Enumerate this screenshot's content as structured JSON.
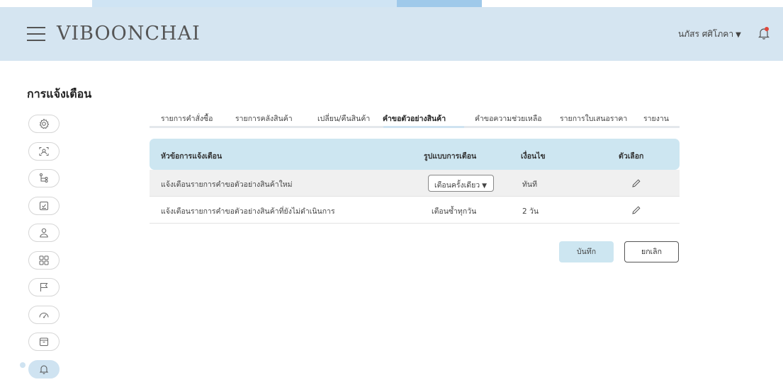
{
  "header": {
    "brand": "VIBOONCHAI",
    "user_name": "นภัสร ศศิโภคา",
    "user_caret": "▼"
  },
  "page": {
    "title": "การแจ้งเตือน"
  },
  "sidebar": {
    "icons": [
      "gear-icon",
      "user-scan-icon",
      "flow-icon",
      "checkbox-icon",
      "person-icon",
      "grid-icon",
      "flag-icon",
      "gauge-icon",
      "box-icon",
      "bell-icon"
    ],
    "active_index": 9
  },
  "tabs": [
    {
      "label": "รายการคำสั่งซื้อ",
      "active": false
    },
    {
      "label": "รายการคลังสินค้า",
      "active": false
    },
    {
      "label": "เปลี่ยน/คืนสินค้า",
      "active": false
    },
    {
      "label": "คำขอตัวอย่างสินค้า",
      "active": true
    },
    {
      "label": "คำขอความช่วยเหลือ",
      "active": false
    },
    {
      "label": "รายการใบเสนอราคา",
      "active": false
    },
    {
      "label": "รายงาน",
      "active": false
    }
  ],
  "table": {
    "columns": [
      "หัวข้อการแจ้งเตือน",
      "รูปแบบการเตือน",
      "เงื่อนไข",
      "ตัวเลือก"
    ],
    "rows": [
      {
        "topic": "แจ้งเตือนรายการคำขอตัวอย่างสินค้าใหม่",
        "mode": "เตือนครั้งเดียว",
        "mode_is_select": true,
        "condition": "ทันที"
      },
      {
        "topic": "แจ้งเตือนรายการคำขอตัวอย่างสินค้าที่ยังไม่ดำเนินการ",
        "mode": "เตือนซ้ำทุกวัน",
        "mode_is_select": false,
        "condition": "2  วัน"
      }
    ],
    "select_caret": "▼"
  },
  "actions": {
    "save_label": "บันทึก",
    "cancel_label": "ยกเลิก"
  },
  "colors": {
    "header_bg": "#d5e5f1",
    "accent": "#cde6f1",
    "notification_dot": "#e0463a"
  }
}
